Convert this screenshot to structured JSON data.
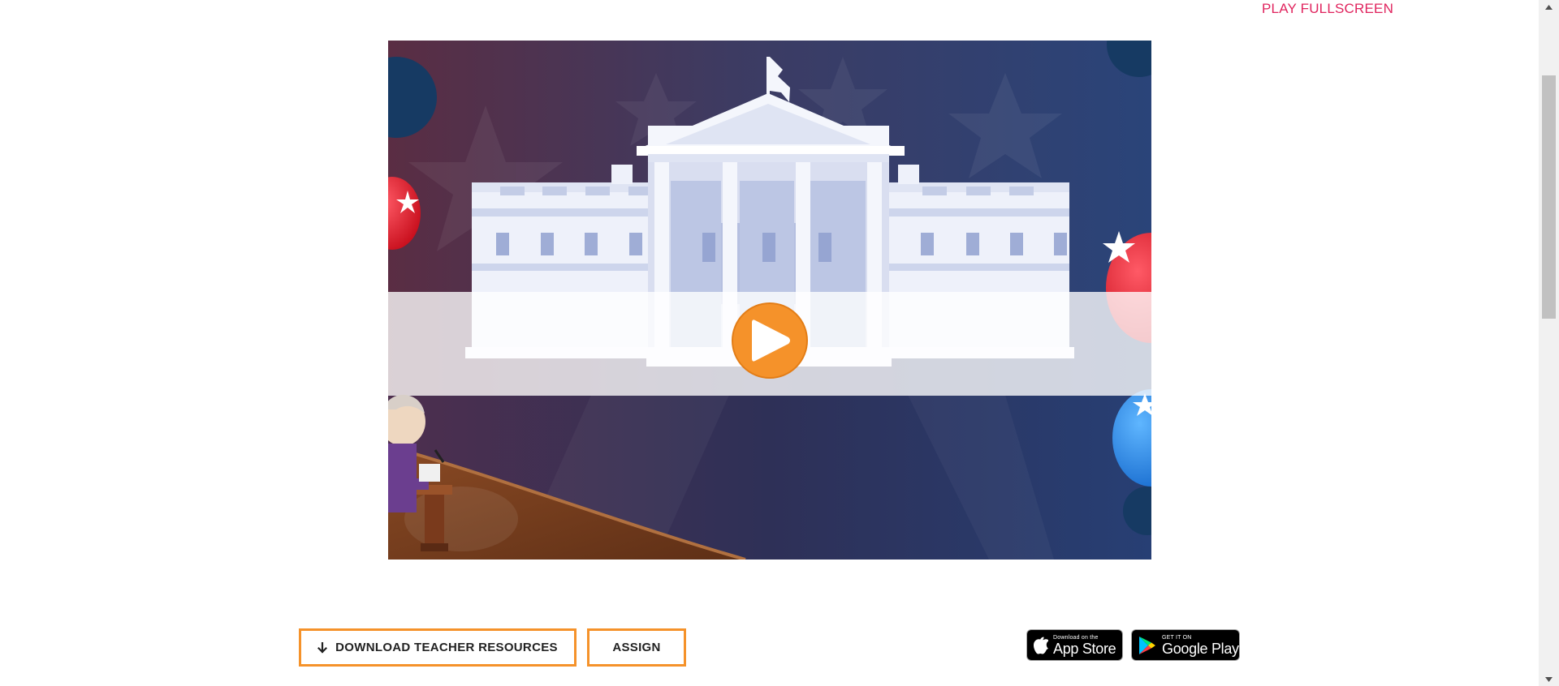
{
  "header": {
    "fullscreen_label": "PLAY FULLSCREEN"
  },
  "game": {
    "play_icon": "play-icon"
  },
  "actions": {
    "download_label": "DOWNLOAD TEACHER RESOURCES",
    "download_icon": "arrow-down-icon",
    "assign_label": "ASSIGN"
  },
  "stores": {
    "apple": {
      "small": "Download on the",
      "big": "App Store"
    },
    "google": {
      "small": "GET IT ON",
      "big": "Google Play"
    }
  },
  "colors": {
    "accent": "#f5922a",
    "link": "#e0245e",
    "play_button": "#f5922a"
  }
}
